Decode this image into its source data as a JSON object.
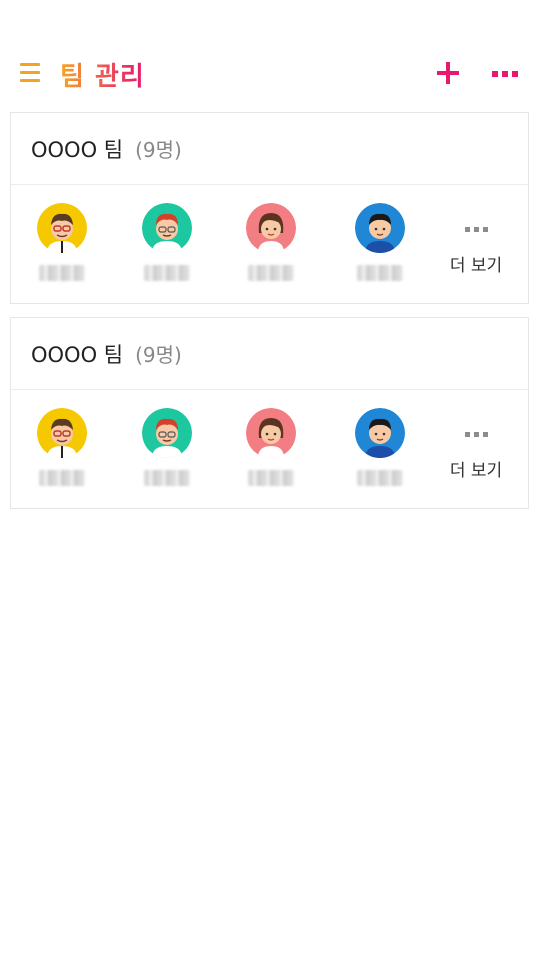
{
  "header": {
    "title": "팀 관리",
    "icons": [
      "menu-icon",
      "add-icon",
      "more-icon"
    ],
    "colors": {
      "menu": "#f2a421",
      "accent": "#e81870"
    }
  },
  "teams": [
    {
      "name": "OOOO 팀",
      "count": "(9명)",
      "more_label": "더 보기",
      "members": [
        {
          "avatar": "man-glasses-yellow"
        },
        {
          "avatar": "man-redhair-teal"
        },
        {
          "avatar": "woman-pink"
        },
        {
          "avatar": "man-blue"
        }
      ]
    },
    {
      "name": "OOOO 팀",
      "count": "(9명)",
      "more_label": "더 보기",
      "members": [
        {
          "avatar": "man-glasses-yellow"
        },
        {
          "avatar": "man-redhair-teal"
        },
        {
          "avatar": "woman-pink"
        },
        {
          "avatar": "man-blue"
        }
      ]
    }
  ]
}
